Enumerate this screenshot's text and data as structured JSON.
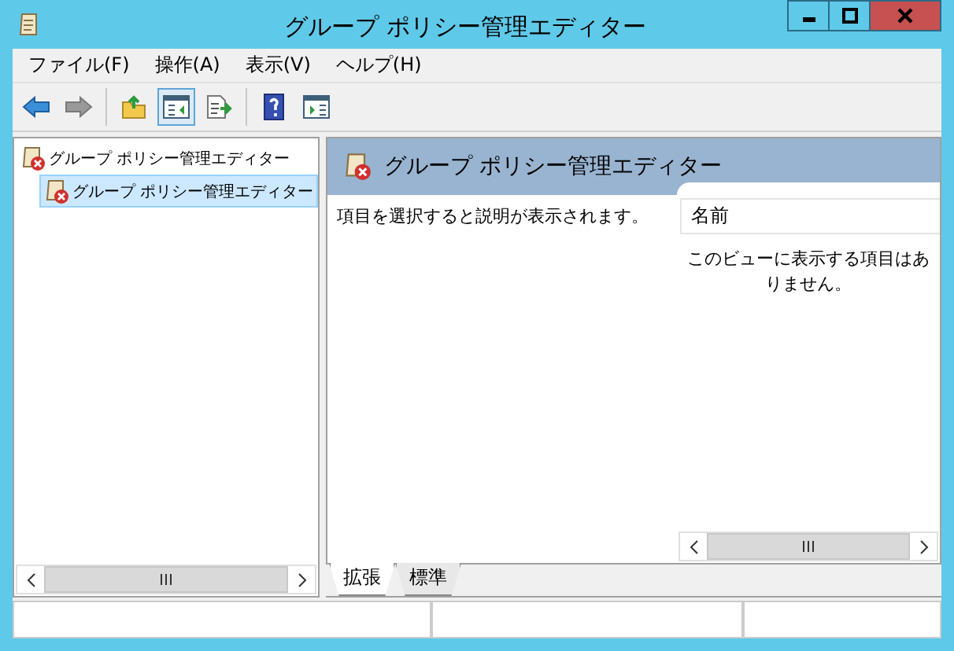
{
  "window": {
    "title": "グループ ポリシー管理エディター"
  },
  "menu": [
    {
      "label": "ファイル(F)"
    },
    {
      "label": "操作(A)"
    },
    {
      "label": "表示(V)"
    },
    {
      "label": "ヘルプ(H)"
    }
  ],
  "toolbar": [
    {
      "kind": "back",
      "disabled": false
    },
    {
      "kind": "forward",
      "disabled": true
    },
    {
      "kind": "separator"
    },
    {
      "kind": "up-folder",
      "disabled": false
    },
    {
      "kind": "toggle-pane",
      "disabled": false,
      "selected": true
    },
    {
      "kind": "export",
      "disabled": false
    },
    {
      "kind": "separator"
    },
    {
      "kind": "help",
      "disabled": false
    },
    {
      "kind": "action-pane",
      "disabled": false
    }
  ],
  "tree": [
    {
      "label": "グループ ポリシー管理エディター",
      "selected": false,
      "children": [
        {
          "label": "グループ ポリシー管理エディター",
          "selected": true
        }
      ]
    }
  ],
  "details": {
    "header": "グループ ポリシー管理エディター",
    "description": "項目を選択すると説明が表示されます。",
    "columns": [
      "名前"
    ],
    "empty_message": "このビューに表示する項目はありません。"
  },
  "tabs": [
    {
      "label": "拡張",
      "selected": true
    },
    {
      "label": "標準",
      "selected": false
    }
  ]
}
